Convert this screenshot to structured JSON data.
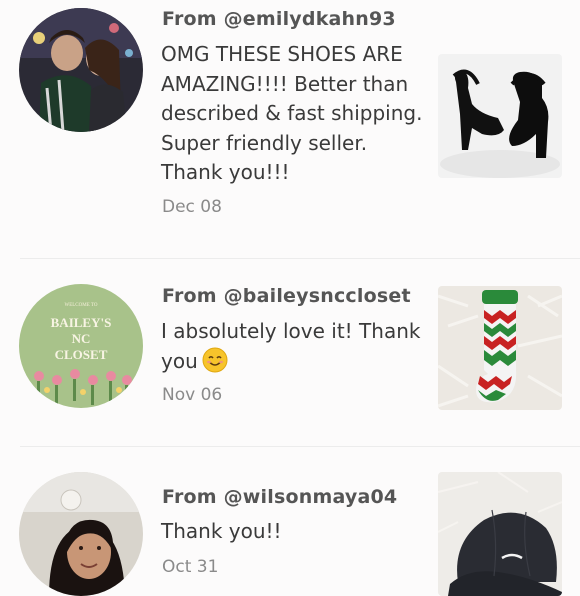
{
  "reviews": [
    {
      "from": "From @emilydkahn93",
      "text": "OMG THESE SHOES ARE AMAZING!!!! Better than described & fast shipping. Super friendly seller. Thank you!!!",
      "date": "Dec 08",
      "avatar_icon": "couple-photo",
      "thumb_icon": "black-heels-photo"
    },
    {
      "from": "From @baileysnccloset",
      "text": "I absolutely love it! Thank you",
      "emoji": "smiling-face-emoji",
      "date": "Nov 06",
      "avatar_icon": "closet-logo",
      "avatar_logo_small": "WELCOME TO",
      "avatar_logo_line1": "BAILEY'S",
      "avatar_logo_line2": "NC",
      "avatar_logo_line3": "CLOSET",
      "thumb_icon": "christmas-stocking-photo"
    },
    {
      "from": "From @wilsonmaya04",
      "text": "Thank you!!",
      "date": "Oct 31",
      "avatar_icon": "selfie-photo",
      "thumb_icon": "black-cap-photo"
    }
  ],
  "colors": {
    "background": "#fcfbfb",
    "divider": "#ececec",
    "logo_green": "#a8c28a"
  }
}
